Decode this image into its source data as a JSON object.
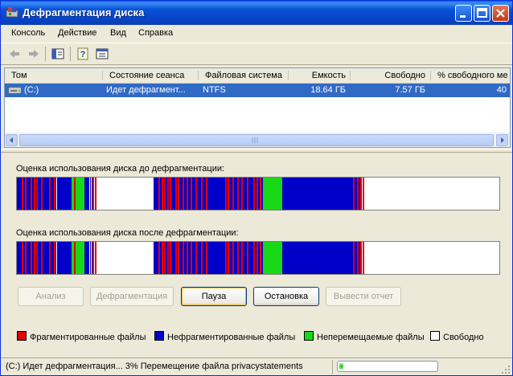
{
  "window": {
    "title": "Дефрагментация диска"
  },
  "menu": {
    "items": [
      "Консоль",
      "Действие",
      "Вид",
      "Справка"
    ]
  },
  "toolbar": {
    "icons": [
      "back-arrow-icon",
      "forward-arrow-icon",
      "show-hide-tree-icon",
      "help-icon",
      "console-tree-icon"
    ]
  },
  "volumes": {
    "columns": [
      "Том",
      "Состояние сеанса",
      "Файловая система",
      "Емкость",
      "Свободно",
      "% свободного ме"
    ],
    "rows": [
      {
        "volume": "(C:)",
        "state": "Идет дефрагмент...",
        "fs": "NTFS",
        "capacity": "18.64 ГБ",
        "free": "7.57 ГБ",
        "free_pct": "40"
      }
    ]
  },
  "analysis": {
    "before_label": "Оценка использования диска до дефрагментации:",
    "after_label": "Оценка использования диска после дефрагментации:"
  },
  "buttons": {
    "analyze": "Анализ",
    "defrag": "Дефрагментация",
    "pause": "Пауза",
    "stop": "Остановка",
    "report": "Вывести отчет"
  },
  "legend": {
    "fragmented": "Фрагментированные файлы",
    "contiguous": "Нефрагментированные файлы",
    "unmovable": "Неперемещаемые файлы",
    "free": "Свободно"
  },
  "colors": {
    "fragmented": "#E00000",
    "contiguous": "#0000C8",
    "unmovable": "#18D918",
    "free": "#FFFFFF"
  },
  "status": {
    "text": "(C:) Идет дефрагментация... 3%  Перемещение файла privacystatements",
    "progress_fraction": 0.03
  }
}
